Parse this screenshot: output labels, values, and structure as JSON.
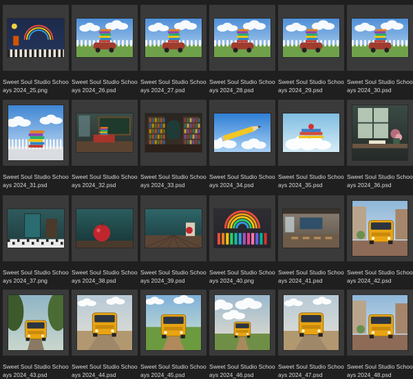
{
  "files": [
    {
      "line1": "Sweet Soul Studio School D",
      "line2": "ays 2024_25.png",
      "scene": "chalk-classroom"
    },
    {
      "line1": "Sweet Soul Studio School D",
      "line2": "ays 2024_26.psd",
      "scene": "books-car-sky"
    },
    {
      "line1": "Sweet Soul Studio School D",
      "line2": "ays 2024_27.psd",
      "scene": "books-car-sky"
    },
    {
      "line1": "Sweet Soul Studio School D",
      "line2": "ays 2024_28.psd",
      "scene": "books-car-sky"
    },
    {
      "line1": "Sweet Soul Studio School D",
      "line2": "ays 2024_29.psd",
      "scene": "books-car-sky"
    },
    {
      "line1": "Sweet Soul Studio School D",
      "line2": "ays 2024_30.psd",
      "scene": "books-car-sky"
    },
    {
      "line1": "Sweet Soul Studio School D",
      "line2": "ays 2024_31.psd",
      "scene": "books-stack-sky"
    },
    {
      "line1": "Sweet Soul Studio School D",
      "line2": "ays 2024_32.psd",
      "scene": "classroom-desk"
    },
    {
      "line1": "Sweet Soul Studio School D",
      "line2": "ays 2024_33.psd",
      "scene": "library-shelves"
    },
    {
      "line1": "Sweet Soul Studio School D",
      "line2": "ays 2024_34.psd",
      "scene": "pencil-sky"
    },
    {
      "line1": "Sweet Soul Studio School D",
      "line2": "ays 2024_35.psd",
      "scene": "books-cloud"
    },
    {
      "line1": "Sweet Soul Studio School D",
      "line2": "ays 2024_36.psd",
      "scene": "window-desk"
    },
    {
      "line1": "Sweet Soul Studio School D",
      "line2": "ays 2024_37.png",
      "scene": "teal-room-door"
    },
    {
      "line1": "Sweet Soul Studio School D",
      "line2": "ays 2024_38.psd",
      "scene": "apple-teal"
    },
    {
      "line1": "Sweet Soul Studio School D",
      "line2": "ays 2024_39.psd",
      "scene": "teal-wall-floor"
    },
    {
      "line1": "Sweet Soul Studio School D",
      "line2": "ays 2024_40.png",
      "scene": "rainbow-crayons"
    },
    {
      "line1": "Sweet Soul Studio School D",
      "line2": "ays 2024_41.psd",
      "scene": "empty-classroom"
    },
    {
      "line1": "Sweet Soul Studio School D",
      "line2": "ays 2024_42.psd",
      "scene": "bus-street"
    },
    {
      "line1": "Sweet Soul Studio School D",
      "line2": "ays 2024_43.psd",
      "scene": "bus-trees"
    },
    {
      "line1": "Sweet Soul Studio School D",
      "line2": "ays 2024_44.psd",
      "scene": "bus-road"
    },
    {
      "line1": "Sweet Soul Studio School D",
      "line2": "ays 2024_45.psd",
      "scene": "bus-field"
    },
    {
      "line1": "Sweet Soul Studio School D",
      "line2": "ays 2024_46.psd",
      "scene": "bus-clouds"
    },
    {
      "line1": "Sweet Soul Studio School D",
      "line2": "ays 2024_47.psd",
      "scene": "bus-road"
    },
    {
      "line1": "Sweet Soul Studio School D",
      "line2": "ays 2024_48.psd",
      "scene": "bus-street"
    }
  ]
}
